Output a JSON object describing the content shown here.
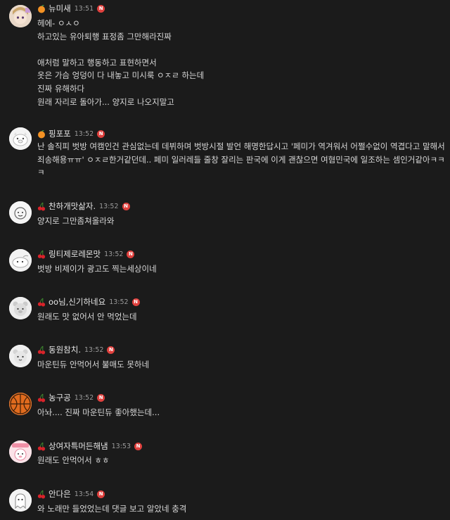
{
  "badges": {
    "orange": "orange-badge-icon",
    "cherry": "cherry-badge-icon"
  },
  "new_marker": "N",
  "comments": [
    {
      "author": "뉴미새",
      "time": "13:51",
      "badge": "orange",
      "avatar": "anime-character",
      "lines": [
        "헤에- ㅇㅅㅇ",
        "하고있는 유아퇴행 표정좀 그만해라진짜",
        "",
        "애처럼 말하고 행동하고 표현하면서",
        "옷은 가슴 엉덩이 다 내놓고 미시룩 ㅇㅈㄹ 하는데",
        "진짜 유해하다",
        "원래 자리로 돌아가... 양지로 나오지말고"
      ]
    },
    {
      "author": "핑포포",
      "time": "13:52",
      "badge": "orange",
      "avatar": "pig",
      "lines": [
        "난 솔직피 벗방 여캠인건 관심없는데 데뷔하며 벗방시절 발언 해명한답시고 '페미가 역겨워서 어쩔수없이 역겹다고 말해서 죄송해용ㅠㅠ' ㅇㅈㄹ한거같던데.. 페미 일러레들 줄창 잘리는 판국에 이게 괜찮으면 여혐민국에 일조하는 셈인거같아ㅋㅋㅋ"
      ]
    },
    {
      "author": "찬하개맛삶자.",
      "time": "13:52",
      "badge": "cherry",
      "avatar": "doodle",
      "lines": [
        "양지로 그만좀쳐올라와"
      ]
    },
    {
      "author": "링티제로레몬맛",
      "time": "13:52",
      "badge": "cherry",
      "avatar": "seal",
      "lines": [
        "벗방 비제이가 광고도 찍는세상이네"
      ]
    },
    {
      "author": "oo님,신기하네요",
      "time": "13:52",
      "badge": "cherry",
      "avatar": "bear",
      "lines": [
        "원래도 맛 없어서 안 먹었는데"
      ]
    },
    {
      "author": "동원참치.",
      "time": "13:52",
      "badge": "cherry",
      "avatar": "bear2",
      "lines": [
        "마운틴듀 안먹어서 불매도 못하네"
      ]
    },
    {
      "author": "농구공",
      "time": "13:52",
      "badge": "cherry",
      "avatar": "basketball",
      "lines": [
        "아놔.... 진짜 마운틴듀 좋아했는데..."
      ]
    },
    {
      "author": "상여자특머든해냄",
      "time": "13:53",
      "badge": "cherry",
      "avatar": "pink-character",
      "lines": [
        "원래도 안먹어서 ㅎㅎ"
      ]
    },
    {
      "author": "안다은",
      "time": "13:54",
      "badge": "cherry",
      "avatar": "ghost",
      "lines": [
        "와 노래만 들었었는데 댓글 보고 알았네 충격"
      ]
    }
  ]
}
